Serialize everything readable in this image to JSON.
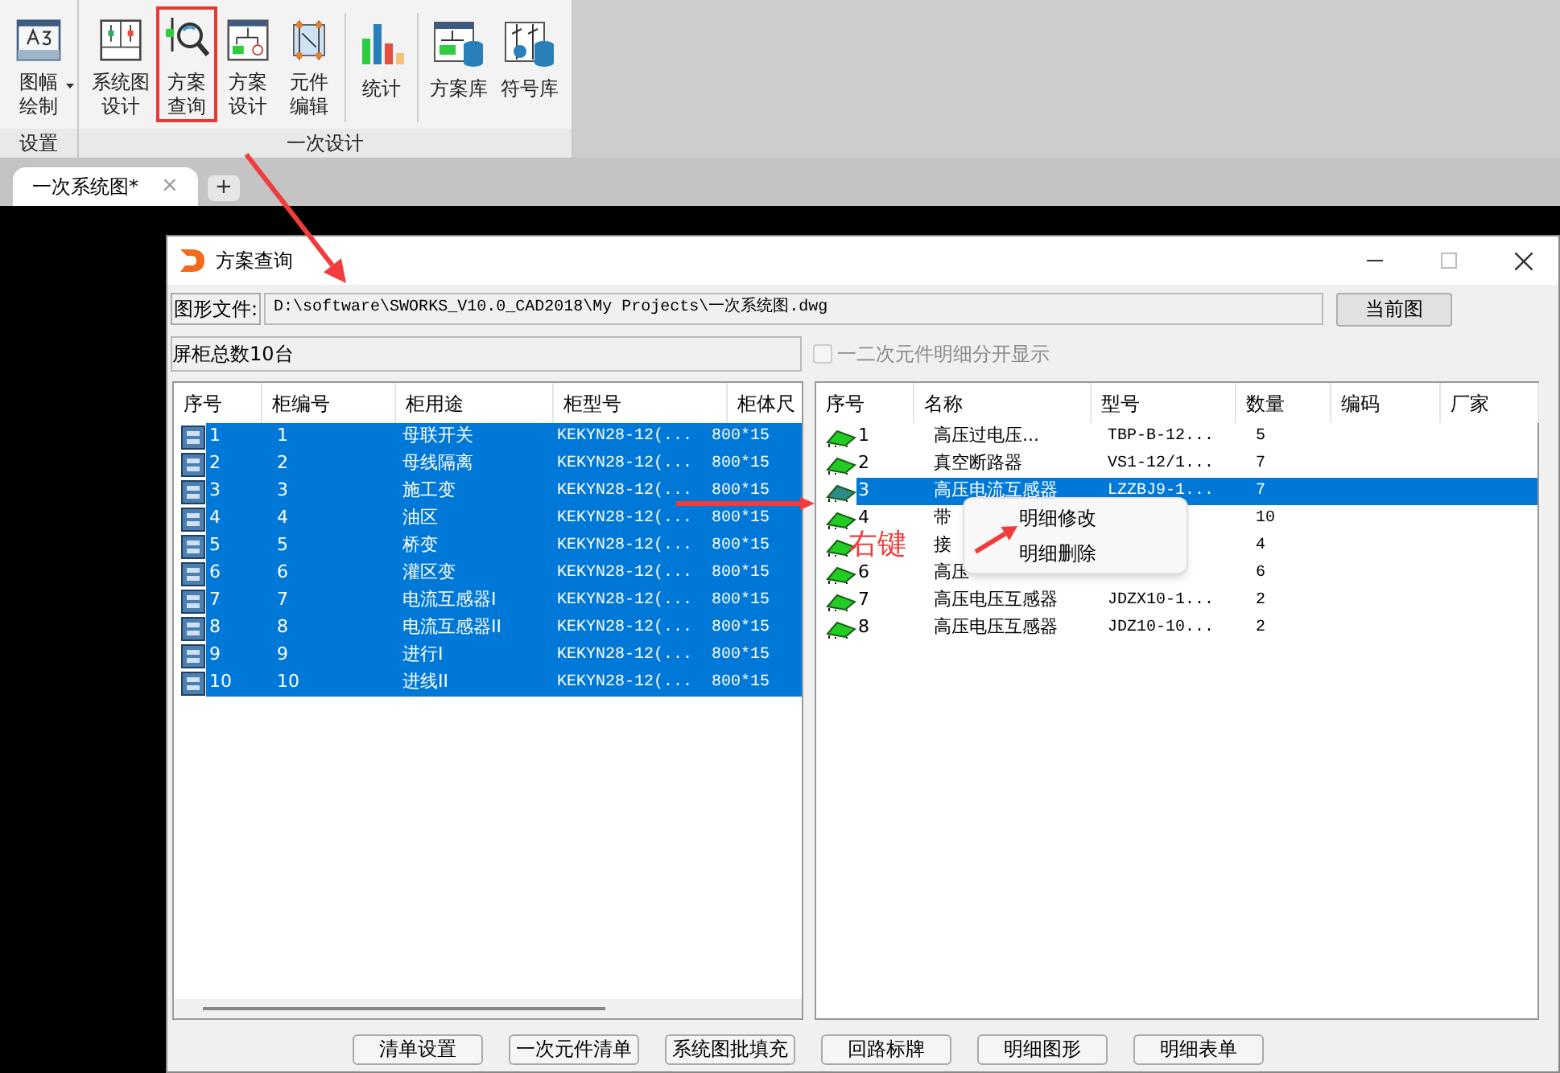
{
  "ribbon": {
    "groups": [
      {
        "label": "设置",
        "sections": [
          [
            {
              "kind": "a3",
              "lines": [
                "图幅",
                "绘制"
              ],
              "dropdown": true,
              "selected": false
            }
          ]
        ]
      },
      {
        "label": "一次设计",
        "sections": [
          [
            {
              "kind": "system",
              "lines": [
                "系统图",
                "设计"
              ],
              "selected": false
            },
            {
              "kind": "query",
              "lines": [
                "方案",
                "查询"
              ],
              "selected": true
            },
            {
              "kind": "design",
              "lines": [
                "方案",
                "设计"
              ],
              "selected": false
            },
            {
              "kind": "edit",
              "lines": [
                "元件",
                "编辑"
              ],
              "selected": false
            }
          ],
          [
            {
              "kind": "stats",
              "lines": [
                "统计"
              ],
              "selected": false
            }
          ],
          [
            {
              "kind": "lib",
              "lines": [
                "方案库"
              ],
              "selected": false
            },
            {
              "kind": "symlib",
              "lines": [
                "符号库"
              ],
              "selected": false
            }
          ]
        ]
      }
    ]
  },
  "doc_tabs": [
    {
      "label": "一次系统图*",
      "close": "×",
      "selected": true
    }
  ],
  "add_tab": "+",
  "dialog": {
    "title": "方案查询",
    "file_label": "图形文件:",
    "file_path": "D:\\software\\SWORKS_V10.0_CAD2018\\My Projects\\一次系统图.dwg",
    "current_button": "当前图",
    "cabinet_count": "屏柜总数10台",
    "split_checkbox": {
      "label": "一二次元件明细分开显示",
      "checked": false,
      "disabled": true
    },
    "cabinets": {
      "columns": [
        "序号",
        "柜编号",
        "柜用途",
        "柜型号",
        "柜体尺"
      ],
      "rows": [
        {
          "cells": [
            "1",
            "1",
            "母联开关",
            "KEKYN28-12(...",
            "800*15"
          ],
          "selected": true
        },
        {
          "cells": [
            "2",
            "2",
            "母线隔离",
            "KEKYN28-12(...",
            "800*15"
          ],
          "selected": true
        },
        {
          "cells": [
            "3",
            "3",
            "施工变",
            "KEKYN28-12(...",
            "800*15"
          ],
          "selected": true
        },
        {
          "cells": [
            "4",
            "4",
            "油区",
            "KEKYN28-12(...",
            "800*15"
          ],
          "selected": true
        },
        {
          "cells": [
            "5",
            "5",
            "桥变",
            "KEKYN28-12(...",
            "800*15"
          ],
          "selected": true
        },
        {
          "cells": [
            "6",
            "6",
            "灌区变",
            "KEKYN28-12(...",
            "800*15"
          ],
          "selected": true
        },
        {
          "cells": [
            "7",
            "7",
            "电流互感器I",
            "KEKYN28-12(...",
            "800*15"
          ],
          "selected": true
        },
        {
          "cells": [
            "8",
            "8",
            "电流互感器II",
            "KEKYN28-12(...",
            "800*15"
          ],
          "selected": true
        },
        {
          "cells": [
            "9",
            "9",
            "进行I",
            "KEKYN28-12(...",
            "800*15"
          ],
          "selected": true
        },
        {
          "cells": [
            "10",
            "10",
            "进线II",
            "KEKYN28-12(...",
            "800*15"
          ],
          "selected": true
        }
      ]
    },
    "details": {
      "columns": [
        "序号",
        "名称",
        "型号",
        "数量",
        "编码",
        "厂家"
      ],
      "rows": [
        {
          "cells": [
            "1",
            "高压过电压...",
            "TBP-B-12...",
            "5"
          ],
          "selected": false
        },
        {
          "cells": [
            "2",
            "真空断路器",
            "VS1-12/1...",
            "7"
          ],
          "selected": false
        },
        {
          "cells": [
            "3",
            "高压电流互感器",
            "LZZBJ9-1...",
            "7"
          ],
          "selected": true
        },
        {
          "cells": [
            "4",
            "带",
            "",
            "10"
          ],
          "selected": false
        },
        {
          "cells": [
            "",
            "接",
            "",
            "4"
          ],
          "selected": false
        },
        {
          "cells": [
            "6",
            "高压",
            "",
            "6"
          ],
          "selected": false
        },
        {
          "cells": [
            "7",
            "高压电压互感器",
            "JDZX10-1...",
            "2"
          ],
          "selected": false
        },
        {
          "cells": [
            "8",
            "高压电压互感器",
            "JDZ10-10...",
            "2"
          ],
          "selected": false
        }
      ]
    },
    "context_menu": [
      "明细修改",
      "明细删除"
    ],
    "annotation": "右键",
    "buttons": [
      "清单设置",
      "一次元件清单",
      "系统图批填充",
      "回路标牌",
      "明细图形",
      "明细表单"
    ]
  }
}
